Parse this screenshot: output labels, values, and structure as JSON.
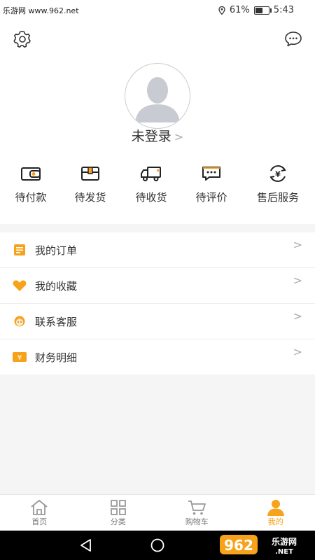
{
  "status_bar": {
    "watermark": "乐游网 www.962.net",
    "battery_percent": "61%",
    "battery_level": 0.61,
    "time": "5:43"
  },
  "header": {
    "login_text": "未登录",
    "login_chevron": ">"
  },
  "orders": [
    {
      "label": "待付款",
      "icon": "wallet-icon"
    },
    {
      "label": "待发货",
      "icon": "box-icon"
    },
    {
      "label": "待收货",
      "icon": "truck-icon"
    },
    {
      "label": "待评价",
      "icon": "comment-icon"
    },
    {
      "label": "售后服务",
      "icon": "yen-exchange-icon"
    }
  ],
  "menu": [
    {
      "label": "我的订单",
      "icon": "order-list-icon",
      "color": "#f7a21b"
    },
    {
      "label": "我的收藏",
      "icon": "heart-icon",
      "color": "#f7a21b"
    },
    {
      "label": "联系客服",
      "icon": "service-icon",
      "color": "#f7a21b"
    },
    {
      "label": "财务明细",
      "icon": "finance-icon",
      "color": "#f7a21b"
    }
  ],
  "menu_arrow": ">",
  "tabs": [
    {
      "label": "首页",
      "icon": "home-icon",
      "active": false
    },
    {
      "label": "分类",
      "icon": "grid-icon",
      "active": false
    },
    {
      "label": "购物车",
      "icon": "cart-icon",
      "active": false
    },
    {
      "label": "我的",
      "icon": "user-icon",
      "active": true
    }
  ],
  "watermark_logo": "962乐游网.NET",
  "colors": {
    "accent": "#f7a21b",
    "text": "#333333",
    "muted": "#777777"
  }
}
